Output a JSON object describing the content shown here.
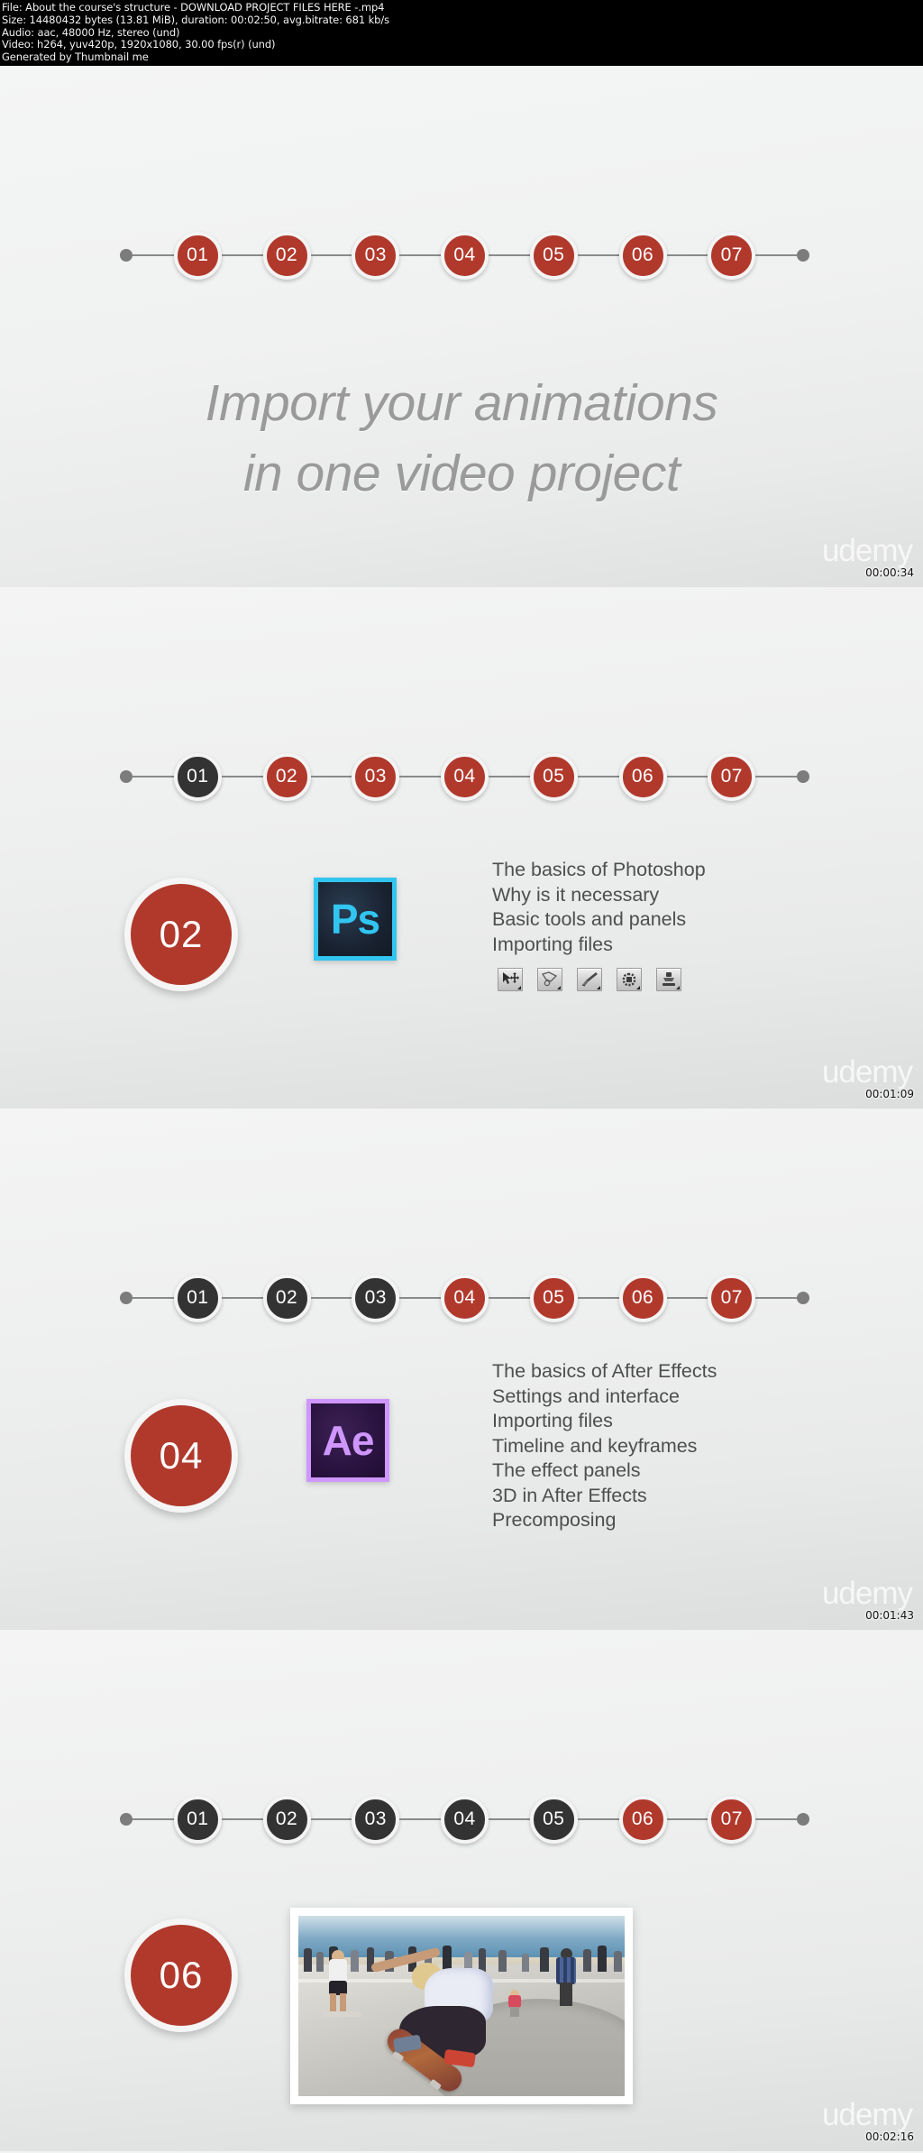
{
  "fileinfo": {
    "line1": "File: About the course's structure  - DOWNLOAD PROJECT FILES HERE -.mp4",
    "line2": "Size: 14480432 bytes (13.81 MiB), duration: 00:02:50, avg.bitrate: 681 kb/s",
    "line3": "Audio: aac, 48000 Hz, stereo (und)",
    "line4": "Video: h264, yuv420p, 1920x1080, 30.00 fps(r) (und)",
    "line5": "Generated by Thumbnail me"
  },
  "colors": {
    "accent_red": "#b0392c",
    "step_done": "#333333",
    "panel_bg": "#f0f1f1",
    "title_gray": "#9a9a9a",
    "ps_cyan": "#31c5f0",
    "ps_dark": "#192230",
    "ae_purple": "#cf96fd",
    "ae_dark": "#2a1340"
  },
  "watermark": "udemy",
  "steps": [
    "01",
    "02",
    "03",
    "04",
    "05",
    "06",
    "07"
  ],
  "panels": [
    {
      "timestamp": "00:00:34",
      "steps_done": 0,
      "title_line1": "Import your animations",
      "title_line2": "in one video project"
    },
    {
      "timestamp": "00:01:09",
      "steps_done": 1,
      "badge": "02",
      "logo": "Ps",
      "bullets": [
        "The basics of Photoshop",
        "Why is it necessary",
        "Basic tools and panels",
        "Importing files"
      ],
      "tool_icons": [
        "move-tool-icon",
        "lasso-tool-icon",
        "brush-tool-icon",
        "selection-tool-icon",
        "stamp-tool-icon"
      ]
    },
    {
      "timestamp": "00:01:43",
      "steps_done": 3,
      "badge": "04",
      "logo": "Ae",
      "bullets": [
        "The basics of After Effects",
        "Settings and interface",
        "Importing files",
        "Timeline and keyframes",
        "The effect panels",
        "3D in After Effects",
        "Precomposing"
      ]
    },
    {
      "timestamp": "00:02:16",
      "steps_done": 5,
      "badge": "06",
      "photo_alt": "skateboarder-in-bowl-photo"
    }
  ]
}
